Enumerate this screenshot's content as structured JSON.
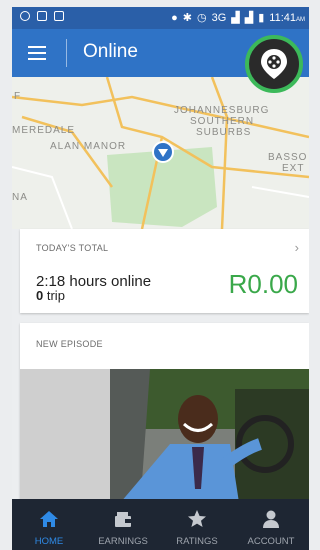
{
  "status_bar": {
    "network": "3G",
    "time": "11:41",
    "time_suffix": "AM"
  },
  "app_bar": {
    "title": "Online"
  },
  "map": {
    "labels": [
      {
        "text": "F"
      },
      {
        "text": "JOHANNESBURG"
      },
      {
        "text": "SOUTHERN"
      },
      {
        "text": "SUBURBS"
      },
      {
        "text": "MEREDALE"
      },
      {
        "text": "ALAN MANOR"
      },
      {
        "text": "BASSO"
      },
      {
        "text": "EXT"
      },
      {
        "text": "NA"
      }
    ]
  },
  "today_card": {
    "heading": "TODAY'S TOTAL",
    "hours": "2:18 hours online",
    "trip_count": "0",
    "trip_label": "trip",
    "amount": "R0.00"
  },
  "episode_card": {
    "heading": "NEW EPISODE"
  },
  "bottom_nav": {
    "tabs": [
      {
        "label": "HOME",
        "active": true
      },
      {
        "label": "EARNINGS",
        "active": false
      },
      {
        "label": "RATINGS",
        "active": false
      },
      {
        "label": "ACCOUNT",
        "active": false
      }
    ]
  },
  "colors": {
    "app_bar": "#2f73c6",
    "status_bar": "#2a5fa8",
    "earnings_green": "#3aa84a",
    "locate_ring": "#3cb95a",
    "nav_background": "#1e2633",
    "nav_active": "#2f8ae6"
  }
}
